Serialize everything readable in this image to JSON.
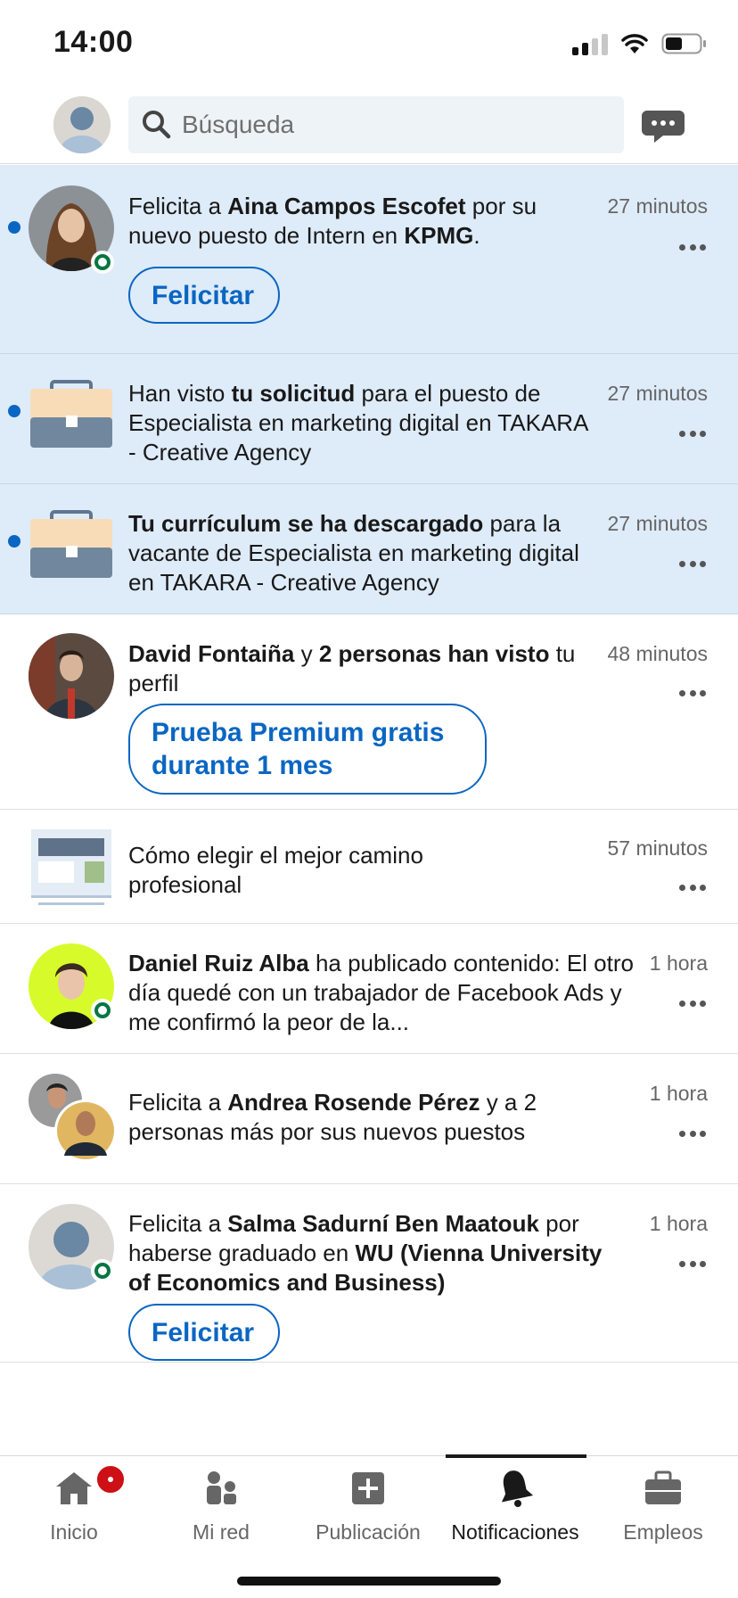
{
  "status_bar": {
    "time": "14:00"
  },
  "search": {
    "placeholder": "Búsqueda"
  },
  "notifications": [
    {
      "unread": true,
      "parts": [
        {
          "t": "Felicita a ",
          "b": false
        },
        {
          "t": "Aina Campos Escofet",
          "b": true
        },
        {
          "t": " por su nuevo puesto de Intern en ",
          "b": false
        },
        {
          "t": "KPMG",
          "b": true
        },
        {
          "t": ".",
          "b": false
        }
      ],
      "time": "27 minutos",
      "action": "Felicitar",
      "icon": "avatar-photo",
      "online": true
    },
    {
      "unread": true,
      "parts": [
        {
          "t": "Han visto ",
          "b": false
        },
        {
          "t": "tu solicitud",
          "b": true
        },
        {
          "t": " para el puesto de Especialista en marketing digital en TAKARA - Creative Agency",
          "b": false
        }
      ],
      "time": "27 minutos",
      "icon": "briefcase-icon"
    },
    {
      "unread": true,
      "parts": [
        {
          "t": "Tu currículum se ha descargado",
          "b": true
        },
        {
          "t": " para la vacante de Especialista en marketing digital en TAKARA - Creative Agency",
          "b": false
        }
      ],
      "time": "27 minutos",
      "icon": "briefcase-icon"
    },
    {
      "unread": false,
      "parts": [
        {
          "t": "David Fontaiña",
          "b": true
        },
        {
          "t": " y ",
          "b": false
        },
        {
          "t": "2 personas han visto",
          "b": true
        },
        {
          "t": " tu perfil",
          "b": false
        }
      ],
      "time": "48 minutos",
      "action": "Prueba Premium gratis durante 1 mes",
      "icon": "avatar-photo"
    },
    {
      "unread": false,
      "parts": [
        {
          "t": "Cómo elegir el mejor camino profesional",
          "b": false
        }
      ],
      "time": "57 minutos",
      "icon": "article-icon"
    },
    {
      "unread": false,
      "parts": [
        {
          "t": "Daniel Ruiz Alba",
          "b": true
        },
        {
          "t": " ha publicado contenido: El otro día quedé con un trabajador de Facebook Ads y me confirmó la peor de la...",
          "b": false
        }
      ],
      "time": "1 hora",
      "icon": "avatar-photo",
      "online": true
    },
    {
      "unread": false,
      "parts": [
        {
          "t": "Felicita a ",
          "b": false
        },
        {
          "t": "Andrea Rosende Pérez",
          "b": true
        },
        {
          "t": " y a 2 personas más por sus nuevos puestos",
          "b": false
        }
      ],
      "time": "1 hora",
      "icon": "group-avatars"
    },
    {
      "unread": false,
      "parts": [
        {
          "t": "Felicita a ",
          "b": false
        },
        {
          "t": "Salma Sadurní Ben Maatouk",
          "b": true
        },
        {
          "t": " por haberse graduado en ",
          "b": false
        },
        {
          "t": "WU (Vienna University of Economics and Business)",
          "b": true
        }
      ],
      "time": "1 hora",
      "action": "Felicitar",
      "icon": "default-avatar",
      "online": true
    }
  ],
  "bottom_nav": [
    {
      "label": "Inicio",
      "icon": "home-icon",
      "badge": true
    },
    {
      "label": "Mi red",
      "icon": "network-icon"
    },
    {
      "label": "Publicación",
      "icon": "post-icon"
    },
    {
      "label": "Notificaciones",
      "icon": "bell-icon",
      "active": true
    },
    {
      "label": "Empleos",
      "icon": "briefcase-icon"
    }
  ],
  "colors": {
    "accent": "#0a66c2",
    "unread_bg": "#deebf9",
    "online": "#057642",
    "badge": "#cc1016"
  }
}
